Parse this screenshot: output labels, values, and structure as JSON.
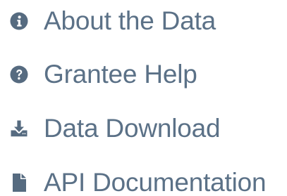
{
  "colors": {
    "text": "#5b7187",
    "icon": "#566b80"
  },
  "nav": {
    "items": [
      {
        "label": "About the Data",
        "icon": "info-circle-icon"
      },
      {
        "label": "Grantee Help",
        "icon": "question-circle-icon"
      },
      {
        "label": "Data Download",
        "icon": "download-icon"
      },
      {
        "label": "API Documentation",
        "icon": "file-icon"
      }
    ]
  }
}
